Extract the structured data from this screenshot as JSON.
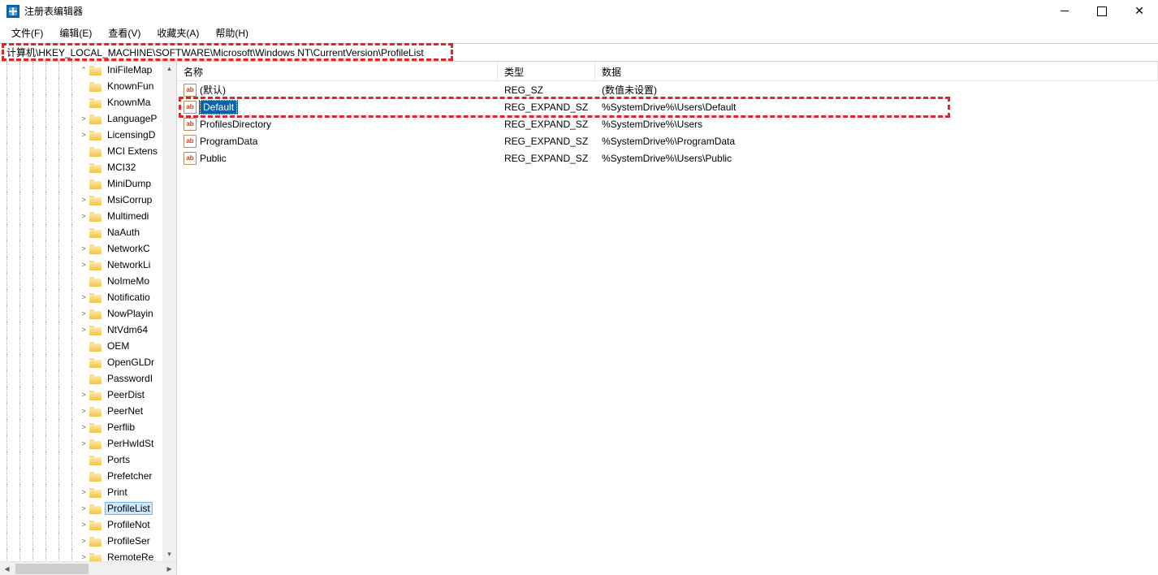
{
  "window": {
    "title": "注册表编辑器"
  },
  "menu": {
    "file": "文件(F)",
    "edit": "编辑(E)",
    "view": "查看(V)",
    "favorites": "收藏夹(A)",
    "help": "帮助(H)"
  },
  "address": {
    "path": "计算机\\HKEY_LOCAL_MACHINE\\SOFTWARE\\Microsoft\\Windows NT\\CurrentVersion\\ProfileList"
  },
  "tree": {
    "items": [
      {
        "label": "IniFileMap",
        "exp": true,
        "up": true
      },
      {
        "label": "KnownFun",
        "exp": false
      },
      {
        "label": "KnownMa",
        "exp": false
      },
      {
        "label": "LanguageP",
        "exp": true
      },
      {
        "label": "LicensingD",
        "exp": true
      },
      {
        "label": "MCI Extens",
        "exp": false
      },
      {
        "label": "MCI32",
        "exp": false
      },
      {
        "label": "MiniDump",
        "exp": false
      },
      {
        "label": "MsiCorrup",
        "exp": true
      },
      {
        "label": "Multimedi",
        "exp": true
      },
      {
        "label": "NaAuth",
        "exp": false
      },
      {
        "label": "NetworkC",
        "exp": true
      },
      {
        "label": "NetworkLi",
        "exp": true
      },
      {
        "label": "NoImeMo",
        "exp": false
      },
      {
        "label": "Notificatio",
        "exp": true
      },
      {
        "label": "NowPlayin",
        "exp": true
      },
      {
        "label": "NtVdm64",
        "exp": true
      },
      {
        "label": "OEM",
        "exp": false
      },
      {
        "label": "OpenGLDr",
        "exp": false
      },
      {
        "label": "PasswordI",
        "exp": false
      },
      {
        "label": "PeerDist",
        "exp": true
      },
      {
        "label": "PeerNet",
        "exp": true
      },
      {
        "label": "Perflib",
        "exp": true
      },
      {
        "label": "PerHwIdSt",
        "exp": true
      },
      {
        "label": "Ports",
        "exp": false
      },
      {
        "label": "Prefetcher",
        "exp": false
      },
      {
        "label": "Print",
        "exp": true
      },
      {
        "label": "ProfileList",
        "exp": true,
        "selected": true
      },
      {
        "label": "ProfileNot",
        "exp": true
      },
      {
        "label": "ProfileSer",
        "exp": true
      },
      {
        "label": "RemoteRe",
        "exp": true
      }
    ]
  },
  "values": {
    "headers": {
      "name": "名称",
      "type": "类型",
      "data": "数据"
    },
    "rows": [
      {
        "name": "(默认)",
        "type": "REG_SZ",
        "data": "(数值未设置)",
        "selected": false
      },
      {
        "name": "Default",
        "type": "REG_EXPAND_SZ",
        "data": "%SystemDrive%\\Users\\Default",
        "selected": true
      },
      {
        "name": "ProfilesDirectory",
        "type": "REG_EXPAND_SZ",
        "data": "%SystemDrive%\\Users",
        "selected": false
      },
      {
        "name": "ProgramData",
        "type": "REG_EXPAND_SZ",
        "data": "%SystemDrive%\\ProgramData",
        "selected": false
      },
      {
        "name": "Public",
        "type": "REG_EXPAND_SZ",
        "data": "%SystemDrive%\\Users\\Public",
        "selected": false
      }
    ]
  },
  "icons": {
    "ab": "ab"
  }
}
